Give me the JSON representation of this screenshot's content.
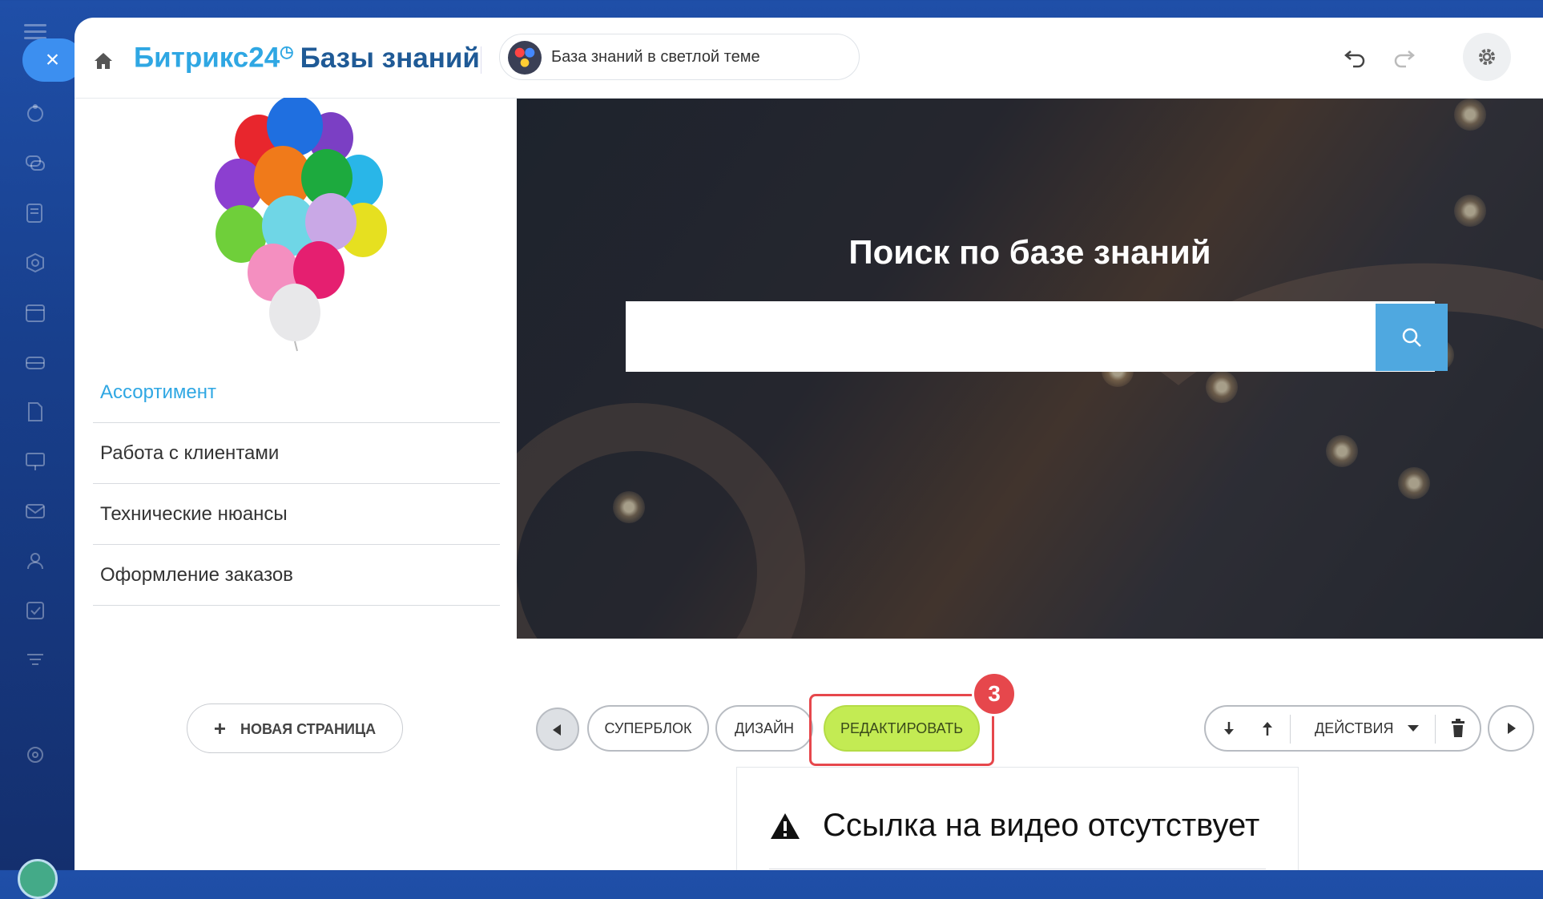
{
  "header": {
    "brand_bitrix": "Битрикс24",
    "brand_clock": "◷",
    "brand_kb": "Базы знаний",
    "site_name": "База знаний в светлой теме"
  },
  "sidebar": {
    "items": [
      {
        "label": "Ассортимент",
        "active": true
      },
      {
        "label": "Работа с клиентами",
        "active": false
      },
      {
        "label": "Технические нюансы",
        "active": false
      },
      {
        "label": "Оформление заказов",
        "active": false
      }
    ],
    "new_page_label": "НОВАЯ СТРАНИЦА"
  },
  "hero": {
    "title": "Поиск по базе знаний"
  },
  "block_toolbar": {
    "superblock_label": "СУПЕРБЛОК",
    "design_label": "ДИЗАЙН",
    "edit_label": "РЕДАКТИРОВАТЬ",
    "actions_label": "ДЕЙСТВИЯ",
    "step_badge": "3"
  },
  "notice": {
    "text": "Ссылка на видео отсутствует"
  },
  "colors": {
    "accent": "#2fa7e3",
    "edit_button": "#c3eb53",
    "highlight": "#e6474c",
    "search_button": "#4fa8e0"
  },
  "icons": [
    "menu-icon",
    "close-icon",
    "home-icon",
    "undo-icon",
    "redo-icon",
    "gear-icon",
    "search-icon",
    "arrow-left-icon",
    "arrow-right-icon",
    "arrow-down-icon",
    "arrow-up-icon",
    "caret-down-icon",
    "trash-icon",
    "warning-icon",
    "plus-icon"
  ]
}
